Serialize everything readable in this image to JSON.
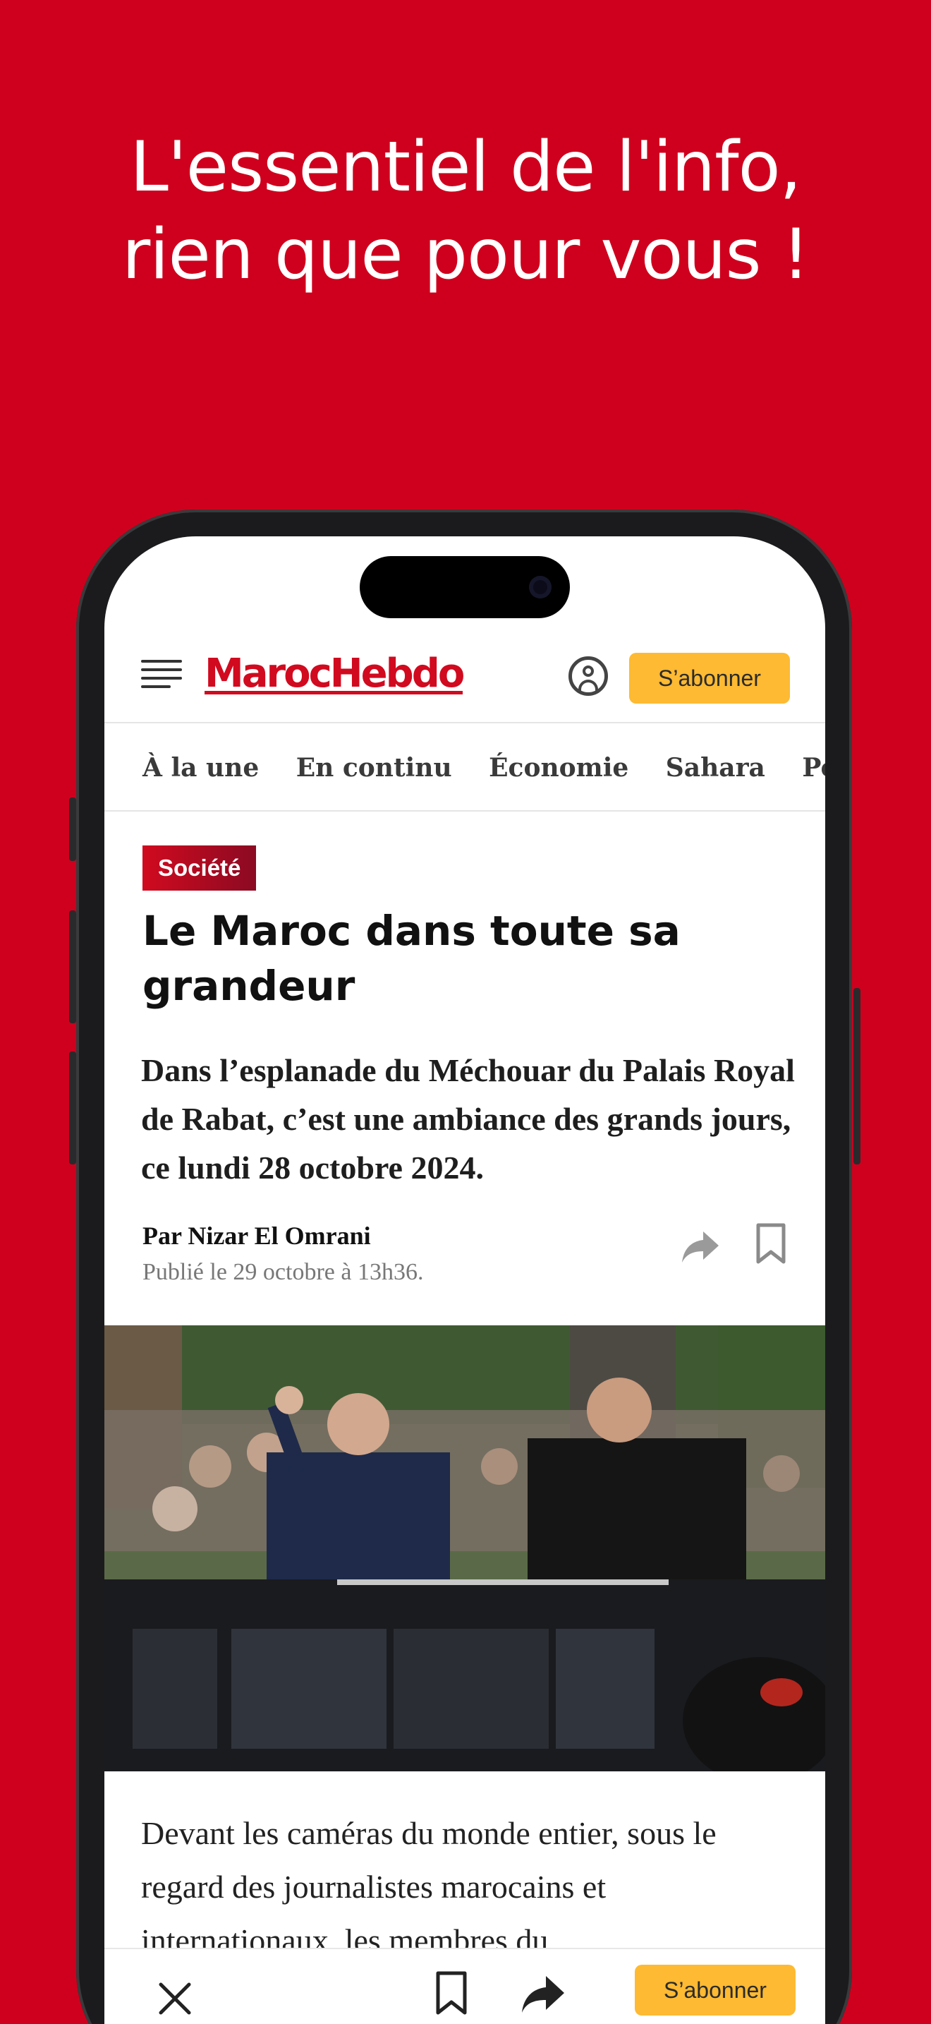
{
  "promo": {
    "headline_line1": "L'essentiel de l'info,",
    "headline_line2": "rien que pour vous !"
  },
  "header": {
    "logo": "MarocHebdo",
    "subscribe_label": "S’abonner"
  },
  "nav": {
    "tabs": [
      "À la une",
      "En continu",
      "Économie",
      "Sahara",
      "Po"
    ]
  },
  "article": {
    "category": "Société",
    "title": "Le Maroc dans toute sa grandeur",
    "lead": "Dans l’esplanade du Méchouar du Palais Royal de Rabat, c’est une ambiance des grands jours, ce lundi 28 octobre 2024.",
    "author": "Par Nizar El Omrani",
    "published": "Publié le 29 octobre à 13h36.",
    "body": "Devant les caméras du monde entier, sous le regard des journalistes marocains et internationaux, les membres du"
  },
  "toolbar": {
    "subscribe_label": "S’abonner"
  },
  "colors": {
    "brand_red": "#CF001D",
    "subscribe_yellow": "#FDBA32"
  },
  "icons": [
    "menu-icon",
    "account-icon",
    "share-icon",
    "bookmark-icon",
    "close-icon"
  ]
}
